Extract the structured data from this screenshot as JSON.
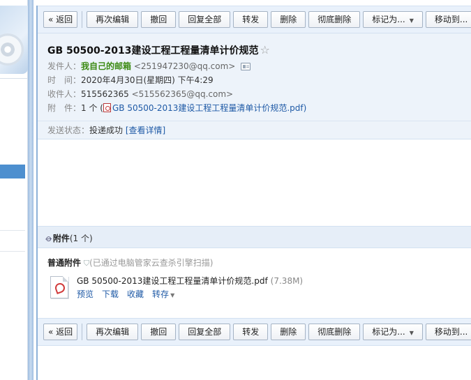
{
  "toolbar": {
    "back": "« 返回",
    "reedit": "再次编辑",
    "undo": "撤回",
    "reply_all": "回复全部",
    "forward": "转发",
    "delete": "删除",
    "delete_permanently": "彻底删除",
    "mark_as": "标记为...",
    "move_to": "移动到..."
  },
  "mail": {
    "subject": "GB 50500-2013建设工程工程量清单计价规范",
    "from_label": "发件人：",
    "from_name": "我自己的邮箱",
    "from_addr": "<251947230@qq.com>",
    "time_label": "时　间：",
    "time_value": "2020年4月30日(星期四) 下午4:29",
    "to_label": "收件人：",
    "to_name": "515562365",
    "to_addr": "<515562365@qq.com>",
    "attach_label": "附　件：",
    "attach_count": "1 个 (",
    "attach_file": "GB 50500-2013建设工程工程量清单计价规范.pdf",
    "attach_close": ")",
    "status_label": "发送状态：",
    "status_value": "投递成功",
    "status_link": "[查看详情]"
  },
  "attachments": {
    "title": "附件",
    "count": "(1 个)",
    "section": "普通附件",
    "scan_note": "(已通过电脑管家云查杀引擎扫描)",
    "file_name": "GB 50500-2013建设工程工程量清单计价规范.pdf",
    "file_size": "(7.38M)",
    "actions": {
      "preview": "预览",
      "download": "下载",
      "favorite": "收藏",
      "save_to": "转存"
    }
  },
  "icons": {
    "star": "star-icon",
    "contact_card": "contact-card-icon",
    "pdf": "pdf-icon",
    "paperclip": "paperclip-icon",
    "shield": "shield-icon"
  },
  "colors": {
    "sender_green": "#3b8a12",
    "link_blue": "#1f5aa6",
    "header_bg": "#edf3fa",
    "toolbar_bg": "#e9f1fb"
  }
}
